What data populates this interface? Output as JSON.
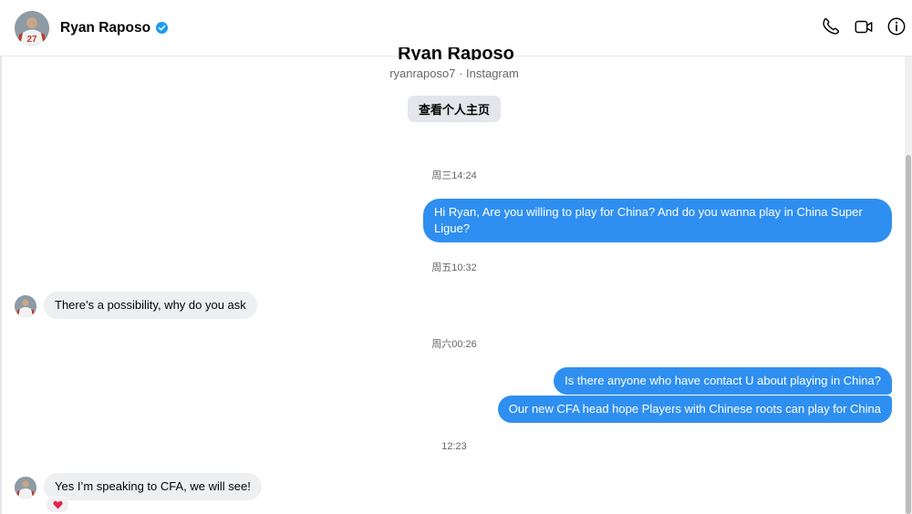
{
  "header": {
    "contact_name": "Ryan Raposo",
    "avatar_jersey_number": "27",
    "actions": [
      "phone-icon",
      "video-call-icon",
      "info-icon"
    ]
  },
  "profile": {
    "subtitle": "ryanraposo7 · Instagram",
    "view_profile_label": "查看个人主页"
  },
  "conversation": {
    "timestamps": [
      "周三14:24",
      "周五10:32",
      "周六00:26",
      "12:23"
    ],
    "messages": [
      {
        "side": "outgoing",
        "text": "Hi Ryan, Are you willing to play for China?  And do you wanna play in China Super Ligue?"
      },
      {
        "side": "incoming",
        "text": "There’s a possibility, why do you ask"
      },
      {
        "side": "outgoing",
        "text": "Is there anyone who have contact U about playing in China?"
      },
      {
        "side": "outgoing",
        "text": "Our new CFA head hope Players with Chinese roots can play for China"
      },
      {
        "side": "incoming",
        "text": "Yes I’m speaking to CFA, we will see!",
        "reaction": "heart-icon"
      }
    ]
  },
  "colors": {
    "outgoing_bubble": "#2f8ff0",
    "incoming_bubble": "#eeeff1",
    "verified_badge": "#1d9bf0",
    "reaction_heart": "#e4264a"
  }
}
